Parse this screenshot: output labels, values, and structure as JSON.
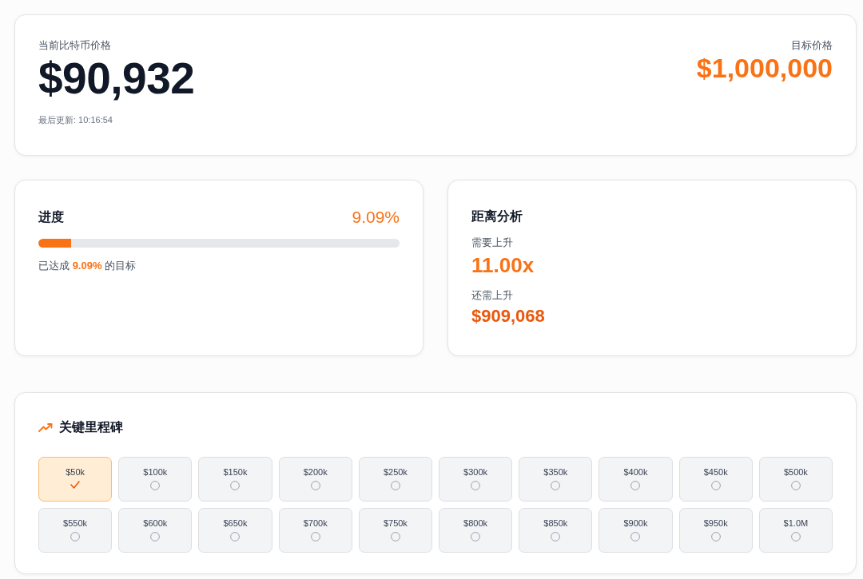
{
  "current": {
    "label": "当前比特币价格",
    "price": "$90,932",
    "updated": "最后更新: 10:16:54"
  },
  "target": {
    "label": "目标价格",
    "price": "$1,000,000"
  },
  "progress": {
    "title": "进度",
    "percent": "9.09%",
    "level": 0.0909,
    "caption": "已达成 **9.09%** 的目标"
  },
  "distance": {
    "title": "距离分析",
    "metrics": [
      {
        "label": "需要上升",
        "value": "11.00x"
      },
      {
        "label": "还需上升",
        "value": "$909,068"
      }
    ]
  },
  "milestones": {
    "title": "关键里程碑",
    "items": [
      {
        "label": "$50k",
        "reached": true
      },
      {
        "label": "$100k",
        "reached": false
      },
      {
        "label": "$150k",
        "reached": false
      },
      {
        "label": "$200k",
        "reached": false
      },
      {
        "label": "$250k",
        "reached": false
      },
      {
        "label": "$300k",
        "reached": false
      },
      {
        "label": "$350k",
        "reached": false
      },
      {
        "label": "$400k",
        "reached": false
      },
      {
        "label": "$450k",
        "reached": false
      },
      {
        "label": "$500k",
        "reached": false
      },
      {
        "label": "$550k",
        "reached": false
      },
      {
        "label": "$600k",
        "reached": false
      },
      {
        "label": "$650k",
        "reached": false
      },
      {
        "label": "$700k",
        "reached": false
      },
      {
        "label": "$750k",
        "reached": false
      },
      {
        "label": "$800k",
        "reached": false
      },
      {
        "label": "$850k",
        "reached": false
      },
      {
        "label": "$900k",
        "reached": false
      },
      {
        "label": "$950k",
        "reached": false
      },
      {
        "label": "$1.0M",
        "reached": false
      }
    ]
  }
}
